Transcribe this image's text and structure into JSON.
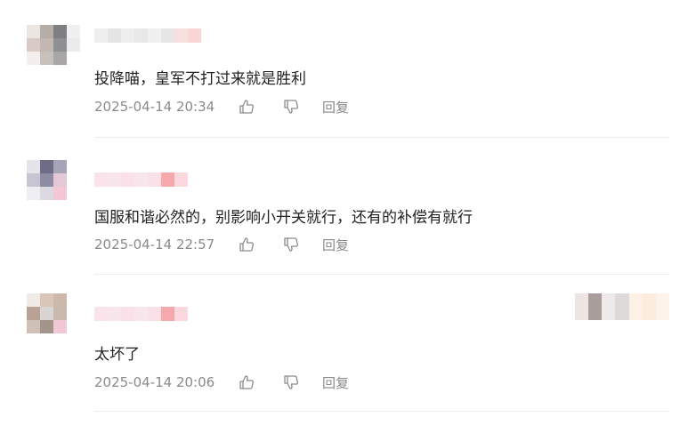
{
  "comments": [
    {
      "text": "投降喵，皇军不打过来就是胜利",
      "date": "2025-04-14 20:34",
      "reply_label": "回复",
      "avatar_colors": [
        "#ece6e3",
        "#b7ada8",
        "#7d7f83",
        "#f0f0f0",
        "#d8cbc6",
        "#c4b6b0",
        "#8e8f92",
        "#ebebeb",
        "#f4efee",
        "#c7c0bd",
        "#a9a6a8",
        "#ffffff",
        "#ffffff",
        "#ffffff",
        "#ffffff",
        "#ffffff"
      ],
      "name_colors": [
        "#eeeeee",
        "#e4e4e4",
        "#eeeeee",
        "#e8e8e8",
        "#f0f0f0",
        "#e6e6e6",
        "#f6e0e0",
        "#fbd6d6"
      ]
    },
    {
      "text": "国服和谐必然的，别影响小开关就行，还有的补偿有就行",
      "date": "2025-04-14 22:57",
      "reply_label": "回复",
      "avatar_colors": [
        "#e6e3ea",
        "#6f6c86",
        "#a7a4b8",
        "#ffffff",
        "#c7c5d2",
        "#8e8ca3",
        "#e3c9d7",
        "#ffffff",
        "#efeef2",
        "#dcd9e3",
        "#f3c7d6",
        "#ffffff",
        "#ffffff",
        "#ffffff",
        "#ffffff",
        "#ffffff"
      ],
      "name_colors": [
        "#fbe3ea",
        "#f9e5ec",
        "#fbe0e8",
        "#f8e6ec",
        "#f9dfe7",
        "#f5a9ad",
        "#fbd8de"
      ]
    },
    {
      "text": "太坏了",
      "date": "2025-04-14 20:06",
      "reply_label": "回复",
      "avatar_colors": [
        "#f0ebe7",
        "#d9c6b8",
        "#cdb9ab",
        "#ffffff",
        "#b9a295",
        "#d8d5d3",
        "#c9b9ae",
        "#ffffff",
        "#cfc1b8",
        "#a4958c",
        "#f2c8d6",
        "#ffffff",
        "#ffffff",
        "#ffffff",
        "#ffffff",
        "#ffffff"
      ],
      "name_colors": [
        "#fbe3ea",
        "#f9e5ec",
        "#fbe0e8",
        "#f8e6ec",
        "#f9dfe7",
        "#f5a9ad",
        "#fbd8de"
      ],
      "right_colors": [
        "#ede5e3",
        "#a99d9c",
        "#eee9eb",
        "#dedad9",
        "#fdf0e4",
        "#fdebdb",
        "#fdf3ea"
      ]
    }
  ],
  "icons": {
    "like": "thumbs-up-icon",
    "dislike": "thumbs-down-icon"
  },
  "colors": {
    "text": "#222222",
    "meta": "#8a8a8a",
    "divider": "#ececec"
  }
}
